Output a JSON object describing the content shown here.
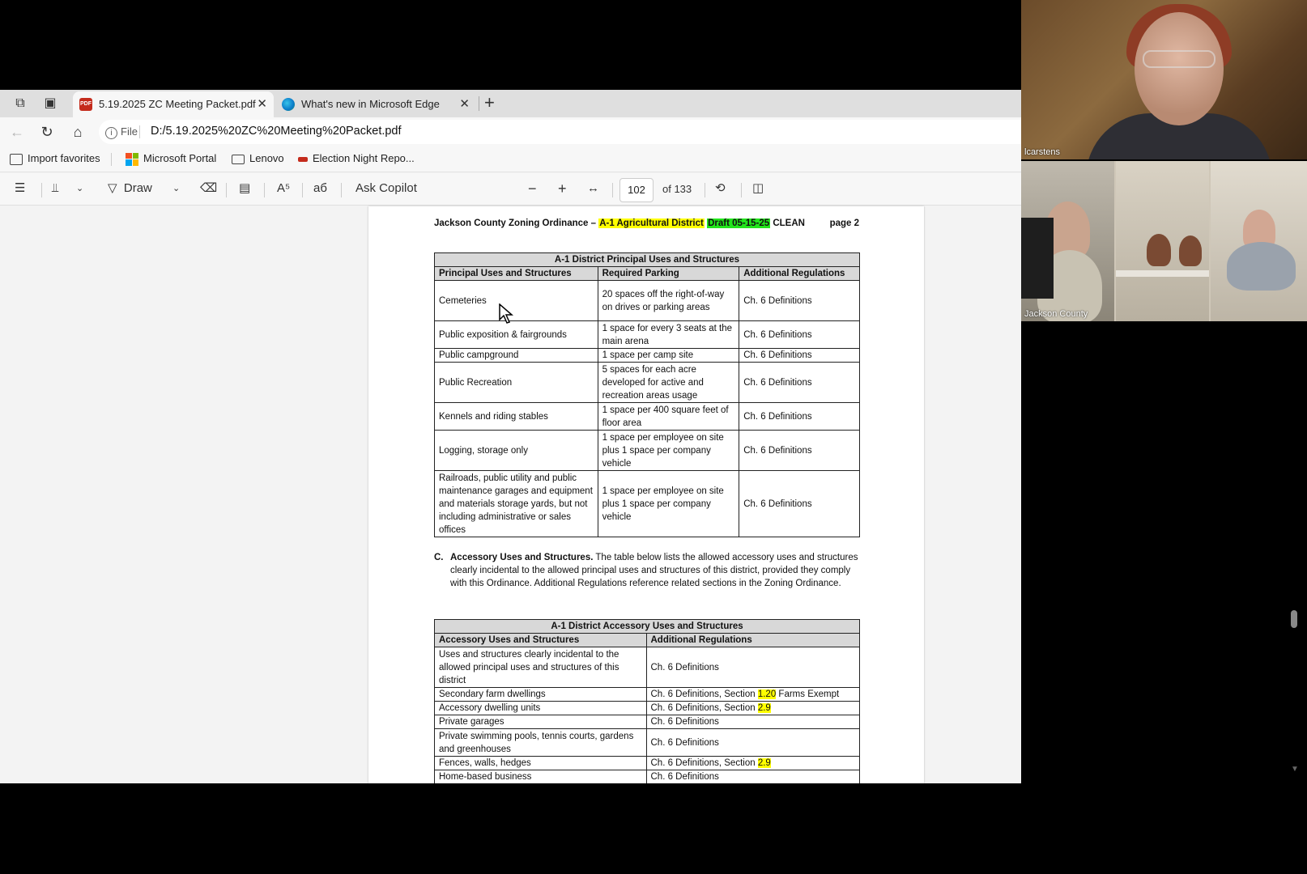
{
  "browser": {
    "tabs": [
      {
        "label": "5.19.2025 ZC Meeting Packet.pdf",
        "active": true,
        "favicon": "pdf-icon"
      },
      {
        "label": "What's new in Microsoft Edge",
        "active": false,
        "favicon": "edge-icon"
      }
    ],
    "address": {
      "scheme_label": "File",
      "url": "D:/5.19.2025%20ZC%20Meeting%20Packet.pdf"
    },
    "favorites": [
      {
        "label": "Import favorites",
        "icon": "import-icon"
      },
      {
        "label": "Microsoft Portal",
        "icon": "microsoft-logo-icon"
      },
      {
        "label": "Lenovo",
        "icon": "folder-icon"
      },
      {
        "label": "Election Night Repo...",
        "icon": "site-icon"
      }
    ]
  },
  "pdf_toolbar": {
    "draw_label": "Draw",
    "copilot_label": "Ask Copilot",
    "page_current": "102",
    "page_total_text": "of 133"
  },
  "document": {
    "header": {
      "prefix": "Jackson County Zoning Ordinance – ",
      "highlight_yellow": "A-1 Agricultural District",
      "highlight_green": "Draft 05-15-25",
      "suffix": " CLEAN",
      "page_label": "page 2"
    },
    "principal_table": {
      "caption": "A-1 District Principal Uses and Structures",
      "columns": [
        "Principal Uses and Structures",
        "Required Parking",
        "Additional Regulations"
      ],
      "rows": [
        [
          "Cemeteries",
          "20 spaces off the right-of-way on drives or parking areas",
          "Ch. 6 Definitions"
        ],
        [
          "Public exposition & fairgrounds",
          "1 space for every 3 seats at the main arena",
          "Ch. 6 Definitions"
        ],
        [
          "Public campground",
          "1 space per camp site",
          "Ch. 6 Definitions"
        ],
        [
          "Public Recreation",
          "5 spaces for each acre developed for active and recreation areas usage",
          "Ch. 6 Definitions"
        ],
        [
          "Kennels and riding stables",
          "1 space per 400 square feet of floor area",
          "Ch. 6 Definitions"
        ],
        [
          "Logging, storage only",
          "1 space per employee on site plus 1 space per company vehicle",
          "Ch. 6 Definitions"
        ],
        [
          "Railroads,  public utility and public maintenance garages and equipment and materials storage yards, but not including administrative or sales offices",
          "1 space per employee on site plus 1 space per company vehicle",
          "Ch. 6 Definitions"
        ]
      ]
    },
    "accessory_section": {
      "letter": "C.",
      "title": "Accessory Uses and Structures.",
      "text": " The table below lists the allowed accessory uses and structures clearly incidental to the allowed principal uses and structures of this district, provided they comply with this Ordinance. Additional Regulations reference related sections in the Zoning Ordinance."
    },
    "accessory_table": {
      "caption": "A-1 District Accessory Uses and Structures",
      "columns": [
        "Accessory Uses and Structures",
        "Additional Regulations"
      ],
      "rows": [
        {
          "use": "Uses and structures clearly incidental to the allowed principal uses and structures of this district",
          "reg": "Ch. 6 Definitions",
          "reg_hl": "",
          "reg_after": ""
        },
        {
          "use": "Secondary farm dwellings",
          "reg": "Ch. 6 Definitions, Section ",
          "reg_hl": "1.20",
          "reg_after": " Farms Exempt"
        },
        {
          "use": "Accessory dwelling units",
          "reg": "Ch. 6 Definitions, Section ",
          "reg_hl": "2.9",
          "reg_after": ""
        },
        {
          "use": "Private garages",
          "reg": "Ch. 6 Definitions",
          "reg_hl": "",
          "reg_after": ""
        },
        {
          "use": "Private swimming pools, tennis courts, gardens and greenhouses",
          "reg": "Ch. 6 Definitions",
          "reg_hl": "",
          "reg_after": ""
        },
        {
          "use": "Fences, walls, hedges",
          "reg": "Ch. 6 Definitions, Section ",
          "reg_hl": "2.9",
          "reg_after": ""
        },
        {
          "use": "Home-based business",
          "reg": "Ch. 6 Definitions",
          "reg_hl": "",
          "reg_after": ""
        }
      ]
    }
  },
  "video": {
    "main_name": "lcarstens",
    "room_name": "Jackson County"
  },
  "colors": {
    "highlight_yellow": "#ffff00",
    "highlight_green": "#22e51c",
    "table_header_bg": "#d8d8d8"
  }
}
